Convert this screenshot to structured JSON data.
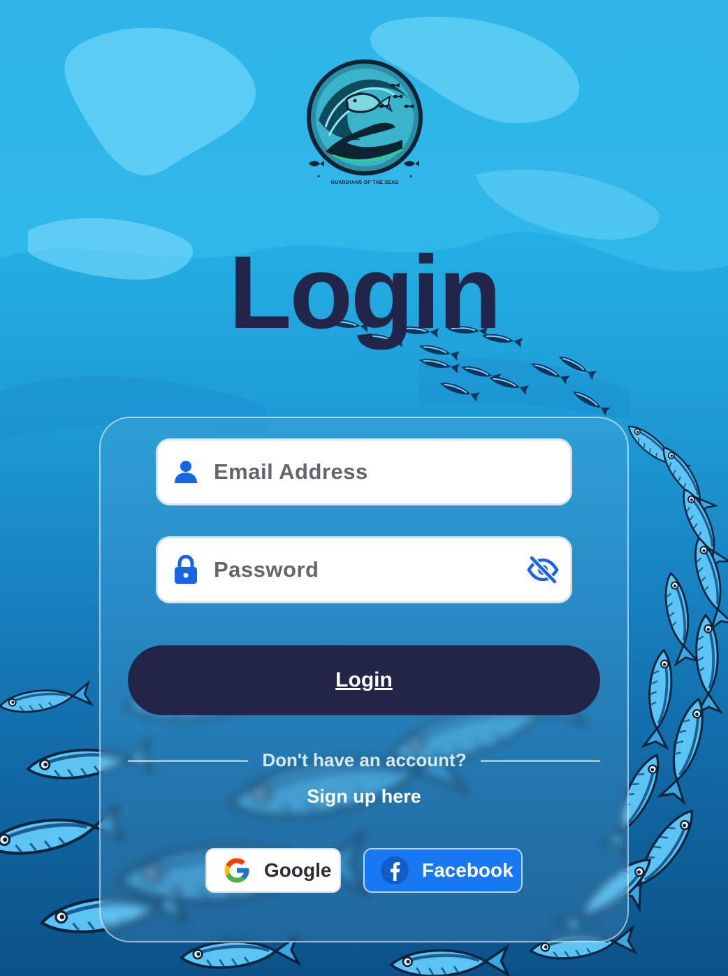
{
  "app": {
    "logo_caption": "GUARDIANS OF THE SEAS",
    "title": "Login"
  },
  "form": {
    "email": {
      "placeholder": "Email Address",
      "value": "",
      "icon": "user-icon"
    },
    "password": {
      "placeholder": "Password",
      "value": "",
      "icon": "lock-icon",
      "toggle_icon": "eye-slash-icon"
    },
    "submit_label": "Login"
  },
  "signup": {
    "prompt": "Don't have an account?",
    "link_label": "Sign up here"
  },
  "social": {
    "google_label": "Google",
    "facebook_label": "Facebook"
  },
  "colors": {
    "accent_dark": "#222548",
    "icon_blue": "#1565e6",
    "facebook_blue": "#1877f2",
    "ocean_blue": "#1fa8df"
  }
}
